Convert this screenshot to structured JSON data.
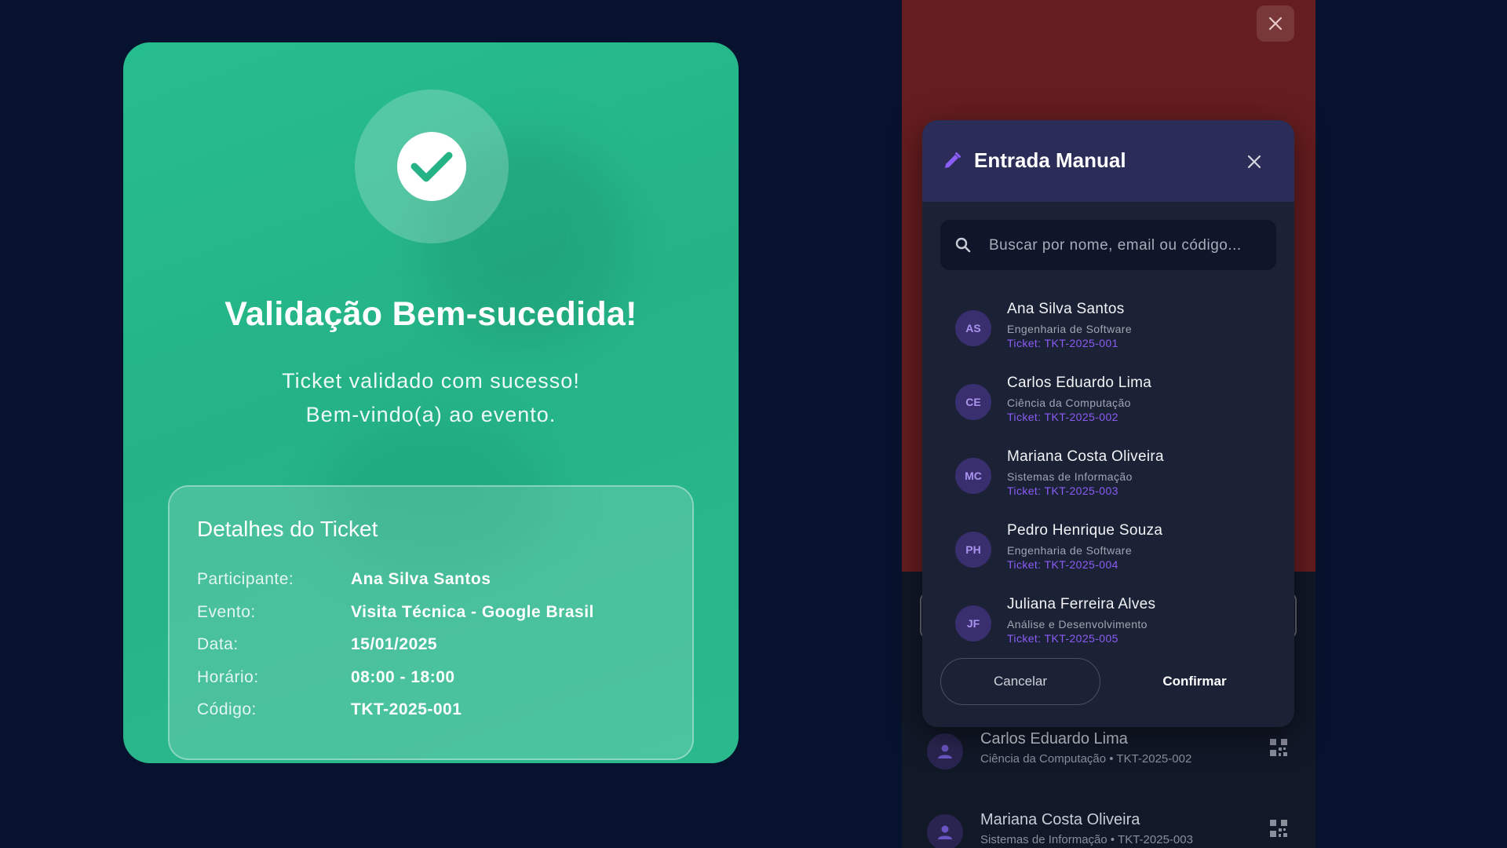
{
  "success": {
    "title": "Validação Bem-sucedida!",
    "subtitle_line1": "Ticket validado com sucesso!",
    "subtitle_line2": "Bem-vindo(a) ao evento.",
    "details": {
      "title": "Detalhes do Ticket",
      "rows": [
        {
          "label": "Participante:",
          "value": "Ana Silva Santos"
        },
        {
          "label": "Evento:",
          "value": "Visita Técnica - Google Brasil"
        },
        {
          "label": "Data:",
          "value": "15/01/2025"
        },
        {
          "label": "Horário:",
          "value": "08:00 - 18:00"
        },
        {
          "label": "Código:",
          "value": "TKT-2025-001"
        }
      ]
    }
  },
  "modal": {
    "title": "Entrada Manual",
    "search_placeholder": "Buscar por nome, email ou código...",
    "items": [
      {
        "initials": "AS",
        "name": "Ana Silva Santos",
        "course": "Engenharia de Software",
        "ticket": "Ticket: TKT-2025-001"
      },
      {
        "initials": "CE",
        "name": "Carlos Eduardo Lima",
        "course": "Ciência da Computação",
        "ticket": "Ticket: TKT-2025-002"
      },
      {
        "initials": "MC",
        "name": "Mariana Costa Oliveira",
        "course": "Sistemas de Informação",
        "ticket": "Ticket: TKT-2025-003"
      },
      {
        "initials": "PH",
        "name": "Pedro Henrique Souza",
        "course": "Engenharia de Software",
        "ticket": "Ticket: TKT-2025-004"
      },
      {
        "initials": "JF",
        "name": "Juliana Ferreira Alves",
        "course": "Análise e Desenvolvimento",
        "ticket": "Ticket: TKT-2025-005"
      }
    ],
    "cancel_label": "Cancelar",
    "confirm_label": "Confirmar"
  },
  "background_list": [
    {
      "name": "Carlos Eduardo Lima",
      "sub": "Ciência da Computação  •  TKT-2025-002"
    },
    {
      "name": "Mariana Costa Oliveira",
      "sub": "Sistemas de Informação  •  TKT-2025-003"
    }
  ],
  "colors": {
    "page_bg": "#07132e",
    "success_green": "#25b386",
    "camera_red": "#661d1f",
    "modal_bg": "#1b2235",
    "accent_purple": "#8b5cf6"
  },
  "icons": [
    "check-icon",
    "pencil-icon",
    "close-icon",
    "search-icon",
    "person-icon",
    "qr-code-icon"
  ]
}
